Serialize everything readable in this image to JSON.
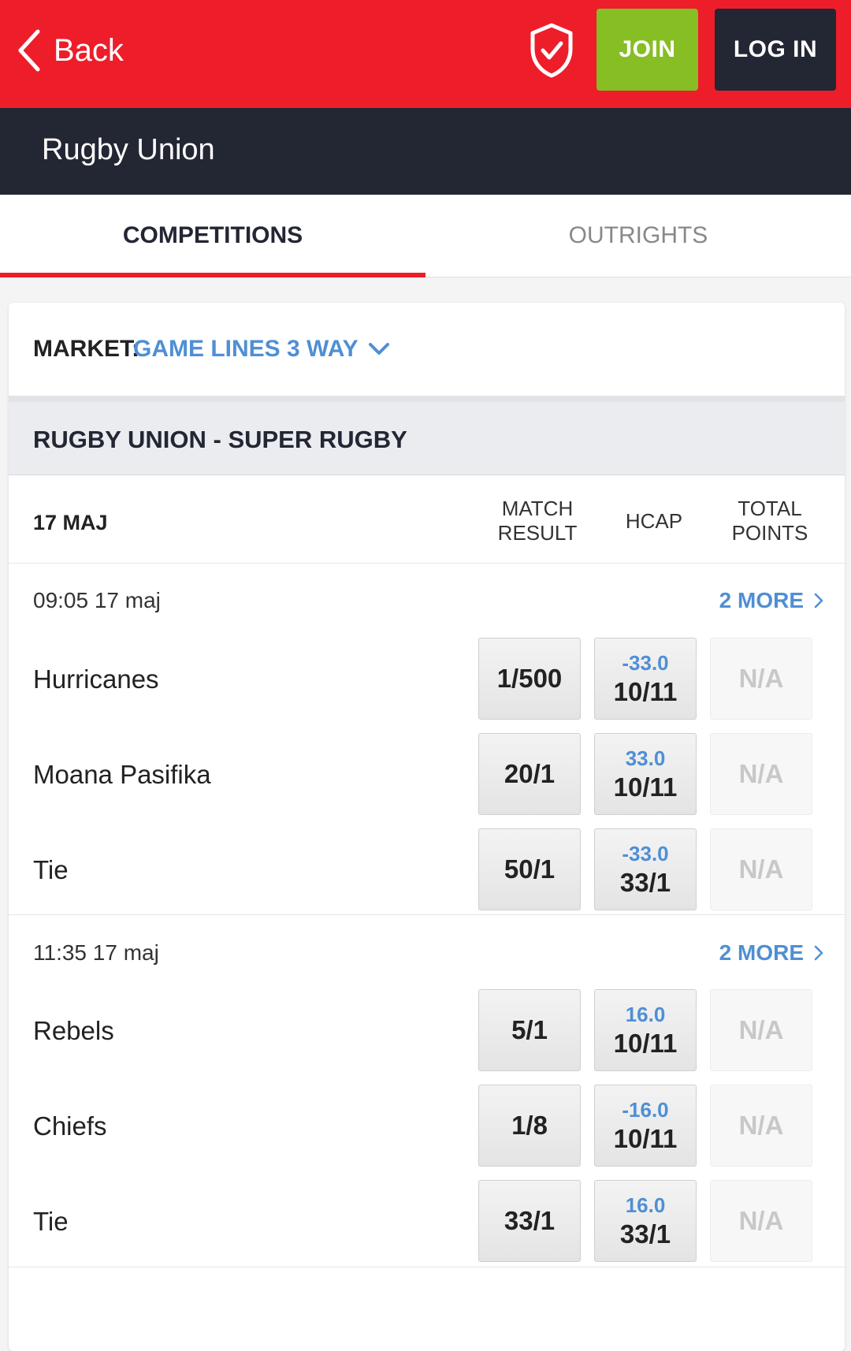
{
  "header": {
    "back_label": "Back",
    "join_label": "JOIN",
    "login_label": "LOG IN"
  },
  "sport": {
    "title": "Rugby Union"
  },
  "tabs": [
    {
      "label": "COMPETITIONS",
      "active": true
    },
    {
      "label": "OUTRIGHTS",
      "active": false
    }
  ],
  "market": {
    "label": "MARKET:",
    "value": "GAME LINES 3 WAY"
  },
  "competition": {
    "title": "RUGBY UNION - SUPER RUGBY"
  },
  "columns": {
    "date": "17 MAJ",
    "match_result": [
      "MATCH",
      "RESULT"
    ],
    "hcap": "HCAP",
    "total_points": [
      "TOTAL",
      "POINTS"
    ]
  },
  "events": [
    {
      "time": "09:05 17 maj",
      "more": "2 MORE",
      "rows": [
        {
          "team": "Hurricanes",
          "result": "1/500",
          "hcap_line": "-33.0",
          "hcap_price": "10/11",
          "total": "N/A"
        },
        {
          "team": "Moana Pasifika",
          "result": "20/1",
          "hcap_line": "33.0",
          "hcap_price": "10/11",
          "total": "N/A"
        },
        {
          "team": "Tie",
          "result": "50/1",
          "hcap_line": "-33.0",
          "hcap_price": "33/1",
          "total": "N/A"
        }
      ]
    },
    {
      "time": "11:35 17 maj",
      "more": "2 MORE",
      "rows": [
        {
          "team": "Rebels",
          "result": "5/1",
          "hcap_line": "16.0",
          "hcap_price": "10/11",
          "total": "N/A"
        },
        {
          "team": "Chiefs",
          "result": "1/8",
          "hcap_line": "-16.0",
          "hcap_price": "10/11",
          "total": "N/A"
        },
        {
          "team": "Tie",
          "result": "33/1",
          "hcap_line": "16.0",
          "hcap_price": "33/1",
          "total": "N/A"
        }
      ]
    }
  ],
  "colors": {
    "brand_red": "#ee1d2a",
    "dark_navy": "#232633",
    "join_green": "#86be23",
    "link_blue": "#4f8fd4"
  }
}
